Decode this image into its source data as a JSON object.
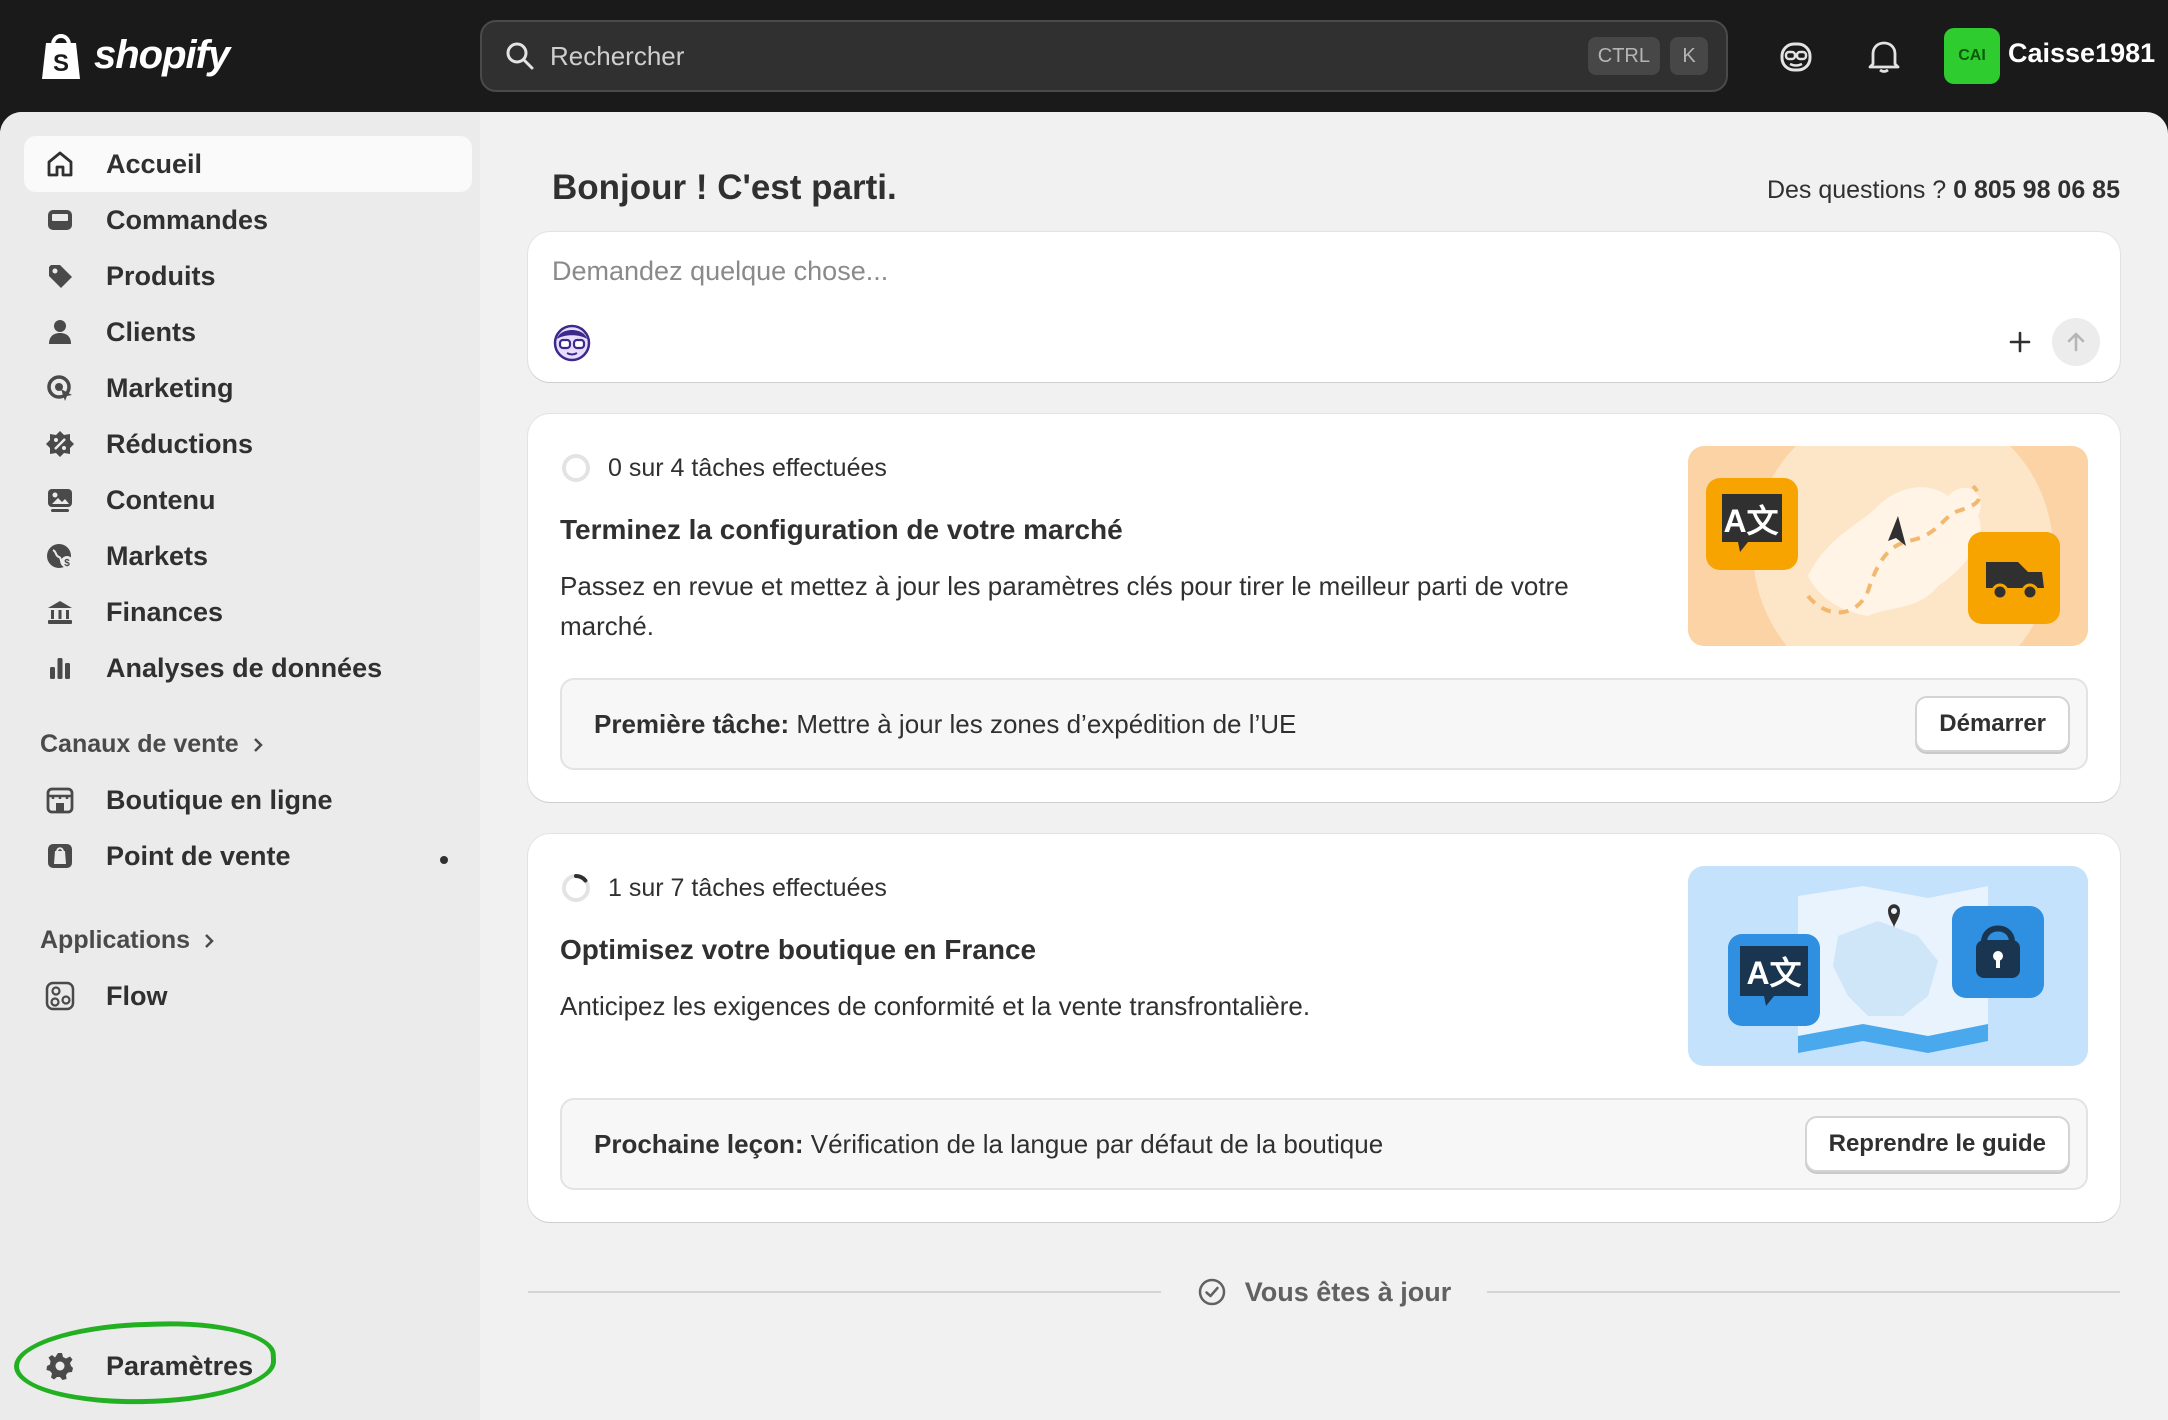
{
  "topbar": {
    "brand": "shopify",
    "search": {
      "placeholder": "Rechercher",
      "shortcut_keys": [
        "CTRL",
        "K"
      ]
    },
    "avatar_initials": "CAI",
    "username": "Caisse1981"
  },
  "sidebar": {
    "items": [
      {
        "label": "Accueil",
        "icon": "home-icon",
        "active": true
      },
      {
        "label": "Commandes",
        "icon": "inbox-icon"
      },
      {
        "label": "Produits",
        "icon": "tag-icon"
      },
      {
        "label": "Clients",
        "icon": "person-icon"
      },
      {
        "label": "Marketing",
        "icon": "target-icon"
      },
      {
        "label": "Réductions",
        "icon": "discount-icon"
      },
      {
        "label": "Contenu",
        "icon": "image-icon"
      },
      {
        "label": "Markets",
        "icon": "globe-icon"
      },
      {
        "label": "Finances",
        "icon": "bank-icon"
      },
      {
        "label": "Analyses de données",
        "icon": "bar-chart-icon"
      }
    ],
    "sales_channels": {
      "heading": "Canaux de vente",
      "items": [
        {
          "label": "Boutique en ligne",
          "icon": "store-icon"
        },
        {
          "label": "Point de vente",
          "icon": "pos-icon"
        }
      ]
    },
    "apps": {
      "heading": "Applications",
      "items": [
        {
          "label": "Flow",
          "icon": "flow-icon"
        }
      ]
    },
    "settings_label": "Paramètres"
  },
  "main": {
    "greeting": "Bonjour ! C'est parti.",
    "help_prefix": "Des questions ?",
    "help_phone": "0 805 98 06 85",
    "ask": {
      "placeholder": "Demandez quelque chose..."
    },
    "cards": [
      {
        "progress": "0 sur 4 tâches effectuées",
        "title": "Terminez la configuration de votre marché",
        "description": "Passez en revue et mettez à jour les paramètres clés pour tirer le meilleur parti de votre marché.",
        "subtask_prefix": "Première tâche:",
        "subtask_text": "Mettre à jour les zones d’expédition de l’UE",
        "button": "Démarrer",
        "completed_fraction": 0
      },
      {
        "progress": "1 sur 7 tâches effectuées",
        "title": "Optimisez votre boutique en France",
        "description": "Anticipez les exigences de conformité et la vente transfrontalière.",
        "subtask_prefix": "Prochaine leçon:",
        "subtask_text": "Vérification de la langue par défaut de la boutique",
        "button": "Reprendre le guide",
        "completed_fraction": 0.143
      }
    ],
    "uptodate": "Vous êtes à jour"
  },
  "colors": {
    "topbar": "#1a1a1a",
    "avatar": "#2ecc2e",
    "highlight": "#22b022"
  }
}
